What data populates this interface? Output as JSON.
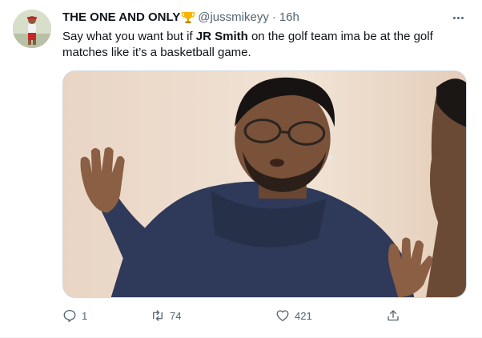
{
  "tweet": {
    "display_name": "THE ONE AND ONLY",
    "trophy_icon": "trophy-emoji-icon",
    "handle": "@jussmikeyy",
    "separator": "·",
    "time": "16h",
    "text_before": "Say what you want but if ",
    "text_bold": "JR Smith",
    "text_after": " on the golf team ima be at the golf matches like it’s a basketball game.",
    "media_alt": "meme-photo"
  },
  "actions": {
    "reply": {
      "icon": "reply-icon",
      "count": "1"
    },
    "retweet": {
      "icon": "retweet-icon",
      "count": "74"
    },
    "like": {
      "icon": "heart-icon",
      "count": "421"
    },
    "share": {
      "icon": "share-icon"
    }
  },
  "colors": {
    "text": "#0f1419",
    "secondary": "#536471",
    "border": "#cfd9de"
  }
}
